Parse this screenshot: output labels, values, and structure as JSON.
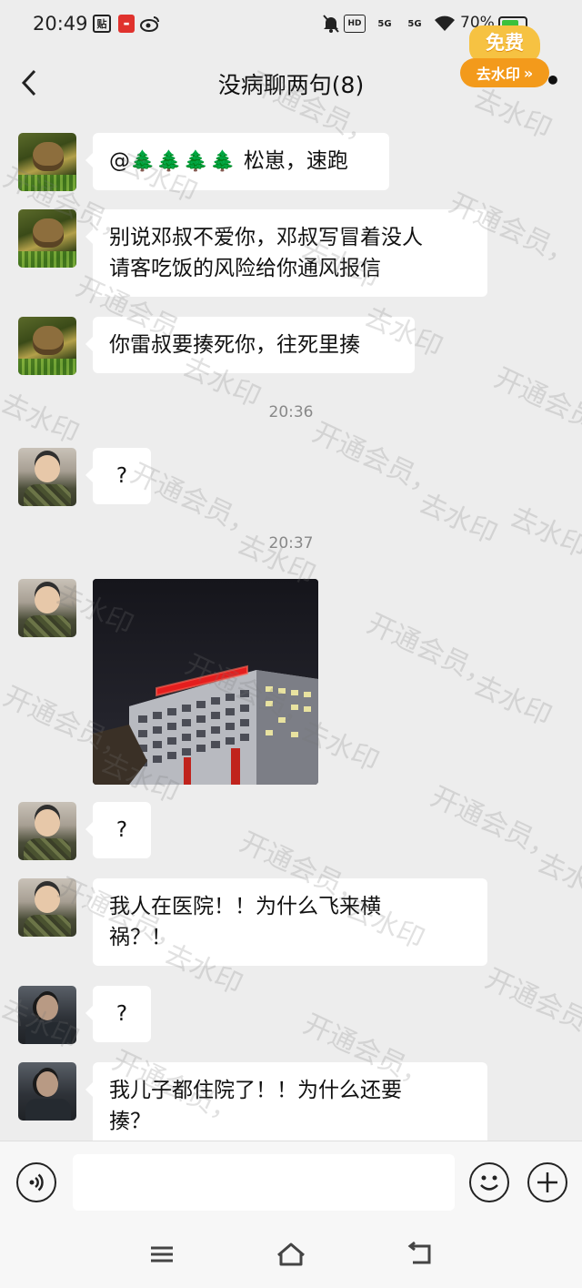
{
  "status_bar": {
    "time": "20:49",
    "battery": "70%",
    "network_1": "5G",
    "network_2": "5G",
    "hd_label": "HD",
    "tie_label": "贴"
  },
  "promo": {
    "badge_label": "免费",
    "button_label": "去水印",
    "button_arrows": "»"
  },
  "header": {
    "title": "没病聊两句(8)"
  },
  "messages": [
    {
      "avatar": "soldier-avatar",
      "text": "松崽，速跑",
      "prefix": "@",
      "trees": "🌲🌲🌲🌲"
    },
    {
      "avatar": "soldier-avatar",
      "text": "别说邓叔不爱你，邓叔写冒着没人\n请客吃饭的风险给你通风报信"
    },
    {
      "avatar": "soldier-avatar",
      "text": "你雷叔要揍死你，往死里揍"
    },
    {
      "timestamp": "20:36"
    },
    {
      "avatar": "boy-avatar",
      "text": "?"
    },
    {
      "timestamp": "20:37"
    },
    {
      "avatar": "boy-avatar",
      "image": "hospital-night-photo"
    },
    {
      "avatar": "boy-avatar",
      "text": "?"
    },
    {
      "avatar": "boy-avatar",
      "text": "我人在医院！！为什么飞来横\n祸？！"
    },
    {
      "avatar": "dark-avatar",
      "text": "?"
    },
    {
      "avatar": "dark-avatar",
      "text": "我儿子都住院了！！为什么还要\n揍？"
    }
  ],
  "watermark": {
    "member": "开通会员，",
    "remove": "去水印"
  },
  "input_bar": {
    "placeholder": ""
  },
  "colors": {
    "background": "#ededed",
    "bubble": "#ffffff",
    "promo_orange": "#f39a1b",
    "promo_yellow": "#f6c242"
  }
}
